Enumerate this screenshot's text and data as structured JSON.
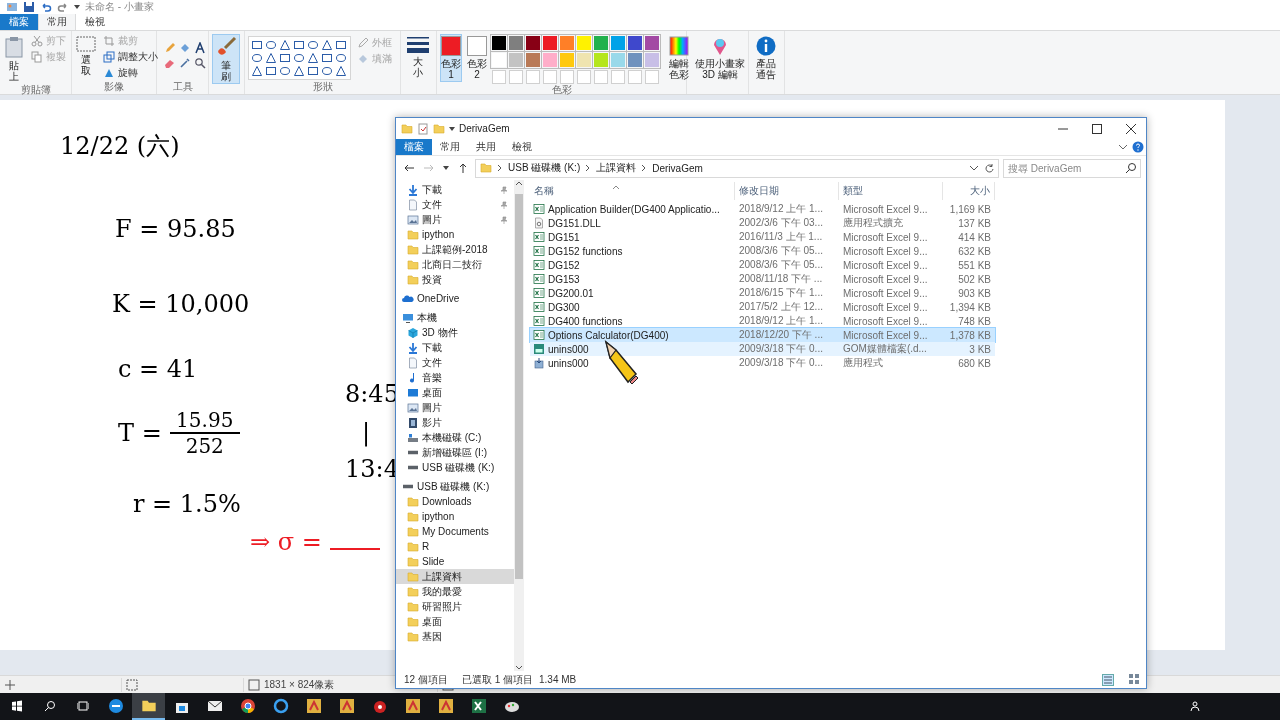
{
  "paint": {
    "title": "未命名 - 小畫家",
    "tabs": [
      {
        "label": "檔案",
        "kind": "file",
        "selected": false
      },
      {
        "label": "常用",
        "kind": "tab",
        "selected": true
      },
      {
        "label": "檢視",
        "kind": "tab",
        "selected": false
      }
    ],
    "ribbon": {
      "clipboard": {
        "label": "剪貼簿",
        "paste": "貼上",
        "actions": [
          {
            "label": "剪下",
            "disabled": true
          },
          {
            "label": "複製",
            "disabled": true
          }
        ]
      },
      "image": {
        "label": "影像",
        "select": "選取",
        "actions": [
          {
            "label": "裁剪",
            "disabled": true
          },
          {
            "label": "調整大小",
            "disabled": false
          },
          {
            "label": "旋轉",
            "disabled": false
          }
        ]
      },
      "tools": {
        "label": "工具"
      },
      "brushes": {
        "label": "筆刷",
        "selected": true
      },
      "shapes": {
        "label": "形狀",
        "options": [
          {
            "label": "外框",
            "disabled": true
          },
          {
            "label": "填滿",
            "disabled": true
          }
        ]
      },
      "size": {
        "label": "大小"
      },
      "colors": {
        "label": "色彩",
        "color_1": {
          "label": "色彩 1",
          "color": "#ed1c24",
          "selected": true
        },
        "color_2": {
          "label": "色彩 2",
          "color": "#ffffff",
          "selected": false
        },
        "palette": [
          {
            "color": "#000000"
          },
          {
            "color": "#7f7f7f"
          },
          {
            "color": "#880015"
          },
          {
            "color": "#ed1c24"
          },
          {
            "color": "#ff7f27"
          },
          {
            "color": "#fff200"
          },
          {
            "color": "#22b14c"
          },
          {
            "color": "#00a2e8"
          },
          {
            "color": "#3f48cc"
          },
          {
            "color": "#a349a4"
          },
          {
            "color": "#ffffff"
          },
          {
            "color": "#c3c3c3"
          },
          {
            "color": "#b97a57"
          },
          {
            "color": "#ffaec9"
          },
          {
            "color": "#ffc90e"
          },
          {
            "color": "#efe4b0"
          },
          {
            "color": "#b5e61d"
          },
          {
            "color": "#99d9ea"
          },
          {
            "color": "#7092be"
          },
          {
            "color": "#c8bfe7"
          }
        ],
        "edit": "編輯色彩"
      },
      "paint3d": "使用小畫家 3D 編輯",
      "notice": "產品通告"
    },
    "canvas_notes": [
      {
        "kind": "line",
        "text": "12/22 (六)",
        "color": "#000000"
      },
      {
        "kind": "line",
        "text": "F = 95.85",
        "color": "#000000"
      },
      {
        "kind": "line",
        "text": "K = 10,000",
        "color": "#000000"
      },
      {
        "kind": "line",
        "text": "c = 41",
        "color": "#000000"
      },
      {
        "kind": "fraction",
        "text": "T =",
        "numerator": "15.95",
        "denominator": "252",
        "color": "#000000"
      },
      {
        "kind": "line",
        "text": "r = 1.5%",
        "color": "#000000"
      },
      {
        "kind": "blank",
        "text": "⇒ σ =",
        "color": "#ed1c24"
      },
      {
        "kind": "line",
        "text": "8:45",
        "color": "#000000"
      },
      {
        "kind": "line",
        "text": "|",
        "color": "#000000"
      },
      {
        "kind": "line",
        "text": "13:4",
        "color": "#000000"
      }
    ],
    "status_bar": {
      "size": "1831 × 824像素"
    }
  },
  "explorer": {
    "title": "DerivaGem",
    "tabs": [
      {
        "label": "檔案",
        "kind": "file",
        "selected": false
      },
      {
        "label": "常用",
        "kind": "tab",
        "selected": false
      },
      {
        "label": "共用",
        "kind": "tab",
        "selected": false
      },
      {
        "label": "檢視",
        "kind": "tab",
        "selected": false
      }
    ],
    "address": [
      "USB 磁碟機 (K:)",
      "上課資料",
      "DerivaGem"
    ],
    "search": {
      "placeholder": "搜尋 DerivaGem"
    },
    "quick_access": [
      {
        "label": "下載",
        "kind": "download",
        "pinned": true,
        "selected": false
      },
      {
        "label": "文件",
        "kind": "document",
        "pinned": true,
        "selected": false
      },
      {
        "label": "圖片",
        "kind": "picture",
        "pinned": true,
        "selected": false
      },
      {
        "label": "ipython",
        "kind": "folder",
        "pinned": false,
        "selected": false
      },
      {
        "label": "上課範例-2018",
        "kind": "folder",
        "pinned": false,
        "selected": false
      },
      {
        "label": "北商日二技衍",
        "kind": "folder",
        "pinned": false,
        "selected": false
      },
      {
        "label": "投資",
        "kind": "folder",
        "pinned": false,
        "selected": false
      }
    ],
    "tree": [
      {
        "label": "OneDrive",
        "kind": "cloud",
        "selected": false
      },
      {
        "label": "本機",
        "kind": "pc",
        "selected": false,
        "children": [
          {
            "label": "3D 物件",
            "kind": "cube",
            "selected": false
          },
          {
            "label": "下載",
            "kind": "download",
            "selected": false
          },
          {
            "label": "文件",
            "kind": "document",
            "selected": false
          },
          {
            "label": "音樂",
            "kind": "music",
            "selected": false
          },
          {
            "label": "桌面",
            "kind": "desktop",
            "selected": false
          },
          {
            "label": "圖片",
            "kind": "picture",
            "selected": false
          },
          {
            "label": "影片",
            "kind": "video",
            "selected": false
          },
          {
            "label": "本機磁碟 (C:)",
            "kind": "system-drive",
            "selected": false
          },
          {
            "label": "新增磁碟區 (I:)",
            "kind": "drive",
            "selected": false
          },
          {
            "label": "USB 磁碟機 (K:)",
            "kind": "drive",
            "selected": false
          }
        ]
      },
      {
        "label": "USB 磁碟機 (K:)",
        "kind": "drive",
        "selected": false,
        "children": [
          {
            "label": "Downloads",
            "kind": "folder",
            "selected": false
          },
          {
            "label": "ipython",
            "kind": "folder",
            "selected": false
          },
          {
            "label": "My Documents",
            "kind": "folder",
            "selected": false
          },
          {
            "label": "R",
            "kind": "folder",
            "selected": false
          },
          {
            "label": "Slide",
            "kind": "folder",
            "selected": false
          },
          {
            "label": "上課資料",
            "kind": "folder",
            "selected": true
          },
          {
            "label": "我的最愛",
            "kind": "folder",
            "selected": false
          },
          {
            "label": "研習照片",
            "kind": "folder",
            "selected": false
          },
          {
            "label": "桌面",
            "kind": "folder",
            "selected": false
          },
          {
            "label": "基因",
            "kind": "folder",
            "selected": false
          }
        ]
      }
    ],
    "columns": [
      "名稱",
      "修改日期",
      "類型",
      "大小"
    ],
    "files": [
      {
        "name": "Application Builder(DG400 Applicatio...",
        "date": "2018/9/12 上午 1...",
        "type": "Microsoft Excel 9...",
        "size": "1,169 KB",
        "kind": "excel",
        "selected": false,
        "hovered": false
      },
      {
        "name": "DG151.DLL",
        "date": "2002/3/6 下午 03...",
        "type": "應用程式擴充",
        "size": "137 KB",
        "kind": "dll",
        "selected": false,
        "hovered": false
      },
      {
        "name": "DG151",
        "date": "2016/11/3 上午 1...",
        "type": "Microsoft Excel 9...",
        "size": "414 KB",
        "kind": "excel",
        "selected": false,
        "hovered": false
      },
      {
        "name": "DG152 functions",
        "date": "2008/3/6 下午 05...",
        "type": "Microsoft Excel 9...",
        "size": "632 KB",
        "kind": "excel",
        "selected": false,
        "hovered": false
      },
      {
        "name": "DG152",
        "date": "2008/3/6 下午 05...",
        "type": "Microsoft Excel 9...",
        "size": "551 KB",
        "kind": "excel",
        "selected": false,
        "hovered": false
      },
      {
        "name": "DG153",
        "date": "2008/11/18 下午 ...",
        "type": "Microsoft Excel 9...",
        "size": "502 KB",
        "kind": "excel",
        "selected": false,
        "hovered": false
      },
      {
        "name": "DG200.01",
        "date": "2018/6/15 下午 1...",
        "type": "Microsoft Excel 9...",
        "size": "903 KB",
        "kind": "excel",
        "selected": false,
        "hovered": false
      },
      {
        "name": "DG300",
        "date": "2017/5/2 上午 12...",
        "type": "Microsoft Excel 9...",
        "size": "1,394 KB",
        "kind": "excel",
        "selected": false,
        "hovered": false
      },
      {
        "name": "DG400 functions",
        "date": "2018/9/12 上午 1...",
        "type": "Microsoft Excel 9...",
        "size": "748 KB",
        "kind": "excel",
        "selected": false,
        "hovered": false
      },
      {
        "name": "Options Calculator(DG400)",
        "date": "2018/12/20 下午 ...",
        "type": "Microsoft Excel 9...",
        "size": "1,378 KB",
        "kind": "excel",
        "selected": true,
        "hovered": false
      },
      {
        "name": "unins000",
        "date": "2009/3/18 下午 0...",
        "type": "GOM媒體檔案(.d...",
        "size": "3 KB",
        "kind": "media",
        "selected": false,
        "hovered": true
      },
      {
        "name": "unins000",
        "date": "2009/3/18 下午 0...",
        "type": "應用程式",
        "size": "680 KB",
        "kind": "setup",
        "selected": false,
        "hovered": false
      }
    ],
    "status": {
      "count": "12 個項目",
      "selection": "已選取 1 個項目",
      "selection_size": "1.34 MB"
    }
  }
}
